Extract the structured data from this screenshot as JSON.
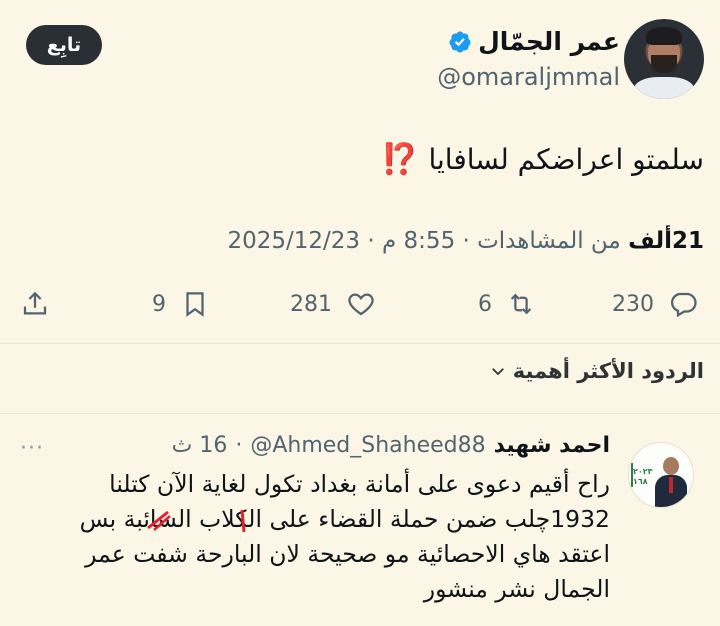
{
  "author": {
    "display_name": "عمر الجمّال",
    "handle": "@omaraljmmal",
    "follow_label": "تابِع",
    "verified_color": "#1d9bf0"
  },
  "tweet": {
    "text": "سلمتو اعراضكم لسافايا",
    "emoji": "⁉️",
    "date": "2025/12/23",
    "separator": "·",
    "time": "8:55 م",
    "views_value": "21ألف",
    "views_label": "من المشاهدات"
  },
  "actions": {
    "replies": "230",
    "reposts": "6",
    "likes": "281",
    "bookmarks": "9"
  },
  "replies_sort": {
    "label": "الردود الأكثر أهمية"
  },
  "reply": {
    "name": "احمد شهيد",
    "handle": "@Ahmed_Shaheed88",
    "separator": "·",
    "time": "16 ث",
    "lines": [
      "راح أقيم دعوى على  أمانة بغداد تكول لغاية الآن كتلنا",
      "1932چلب ضمن حملة القضاء على الكلاب السائبة  بس",
      "اعتقد هاي الاحصائية مو صحيحة لان البارحة شفت عمر",
      "الجمال نشر منشور"
    ],
    "more": "···"
  },
  "colors": {
    "background": "#fbf6e6",
    "text": "#0f1419",
    "muted": "#536471",
    "accent_red": "#e1232f"
  }
}
